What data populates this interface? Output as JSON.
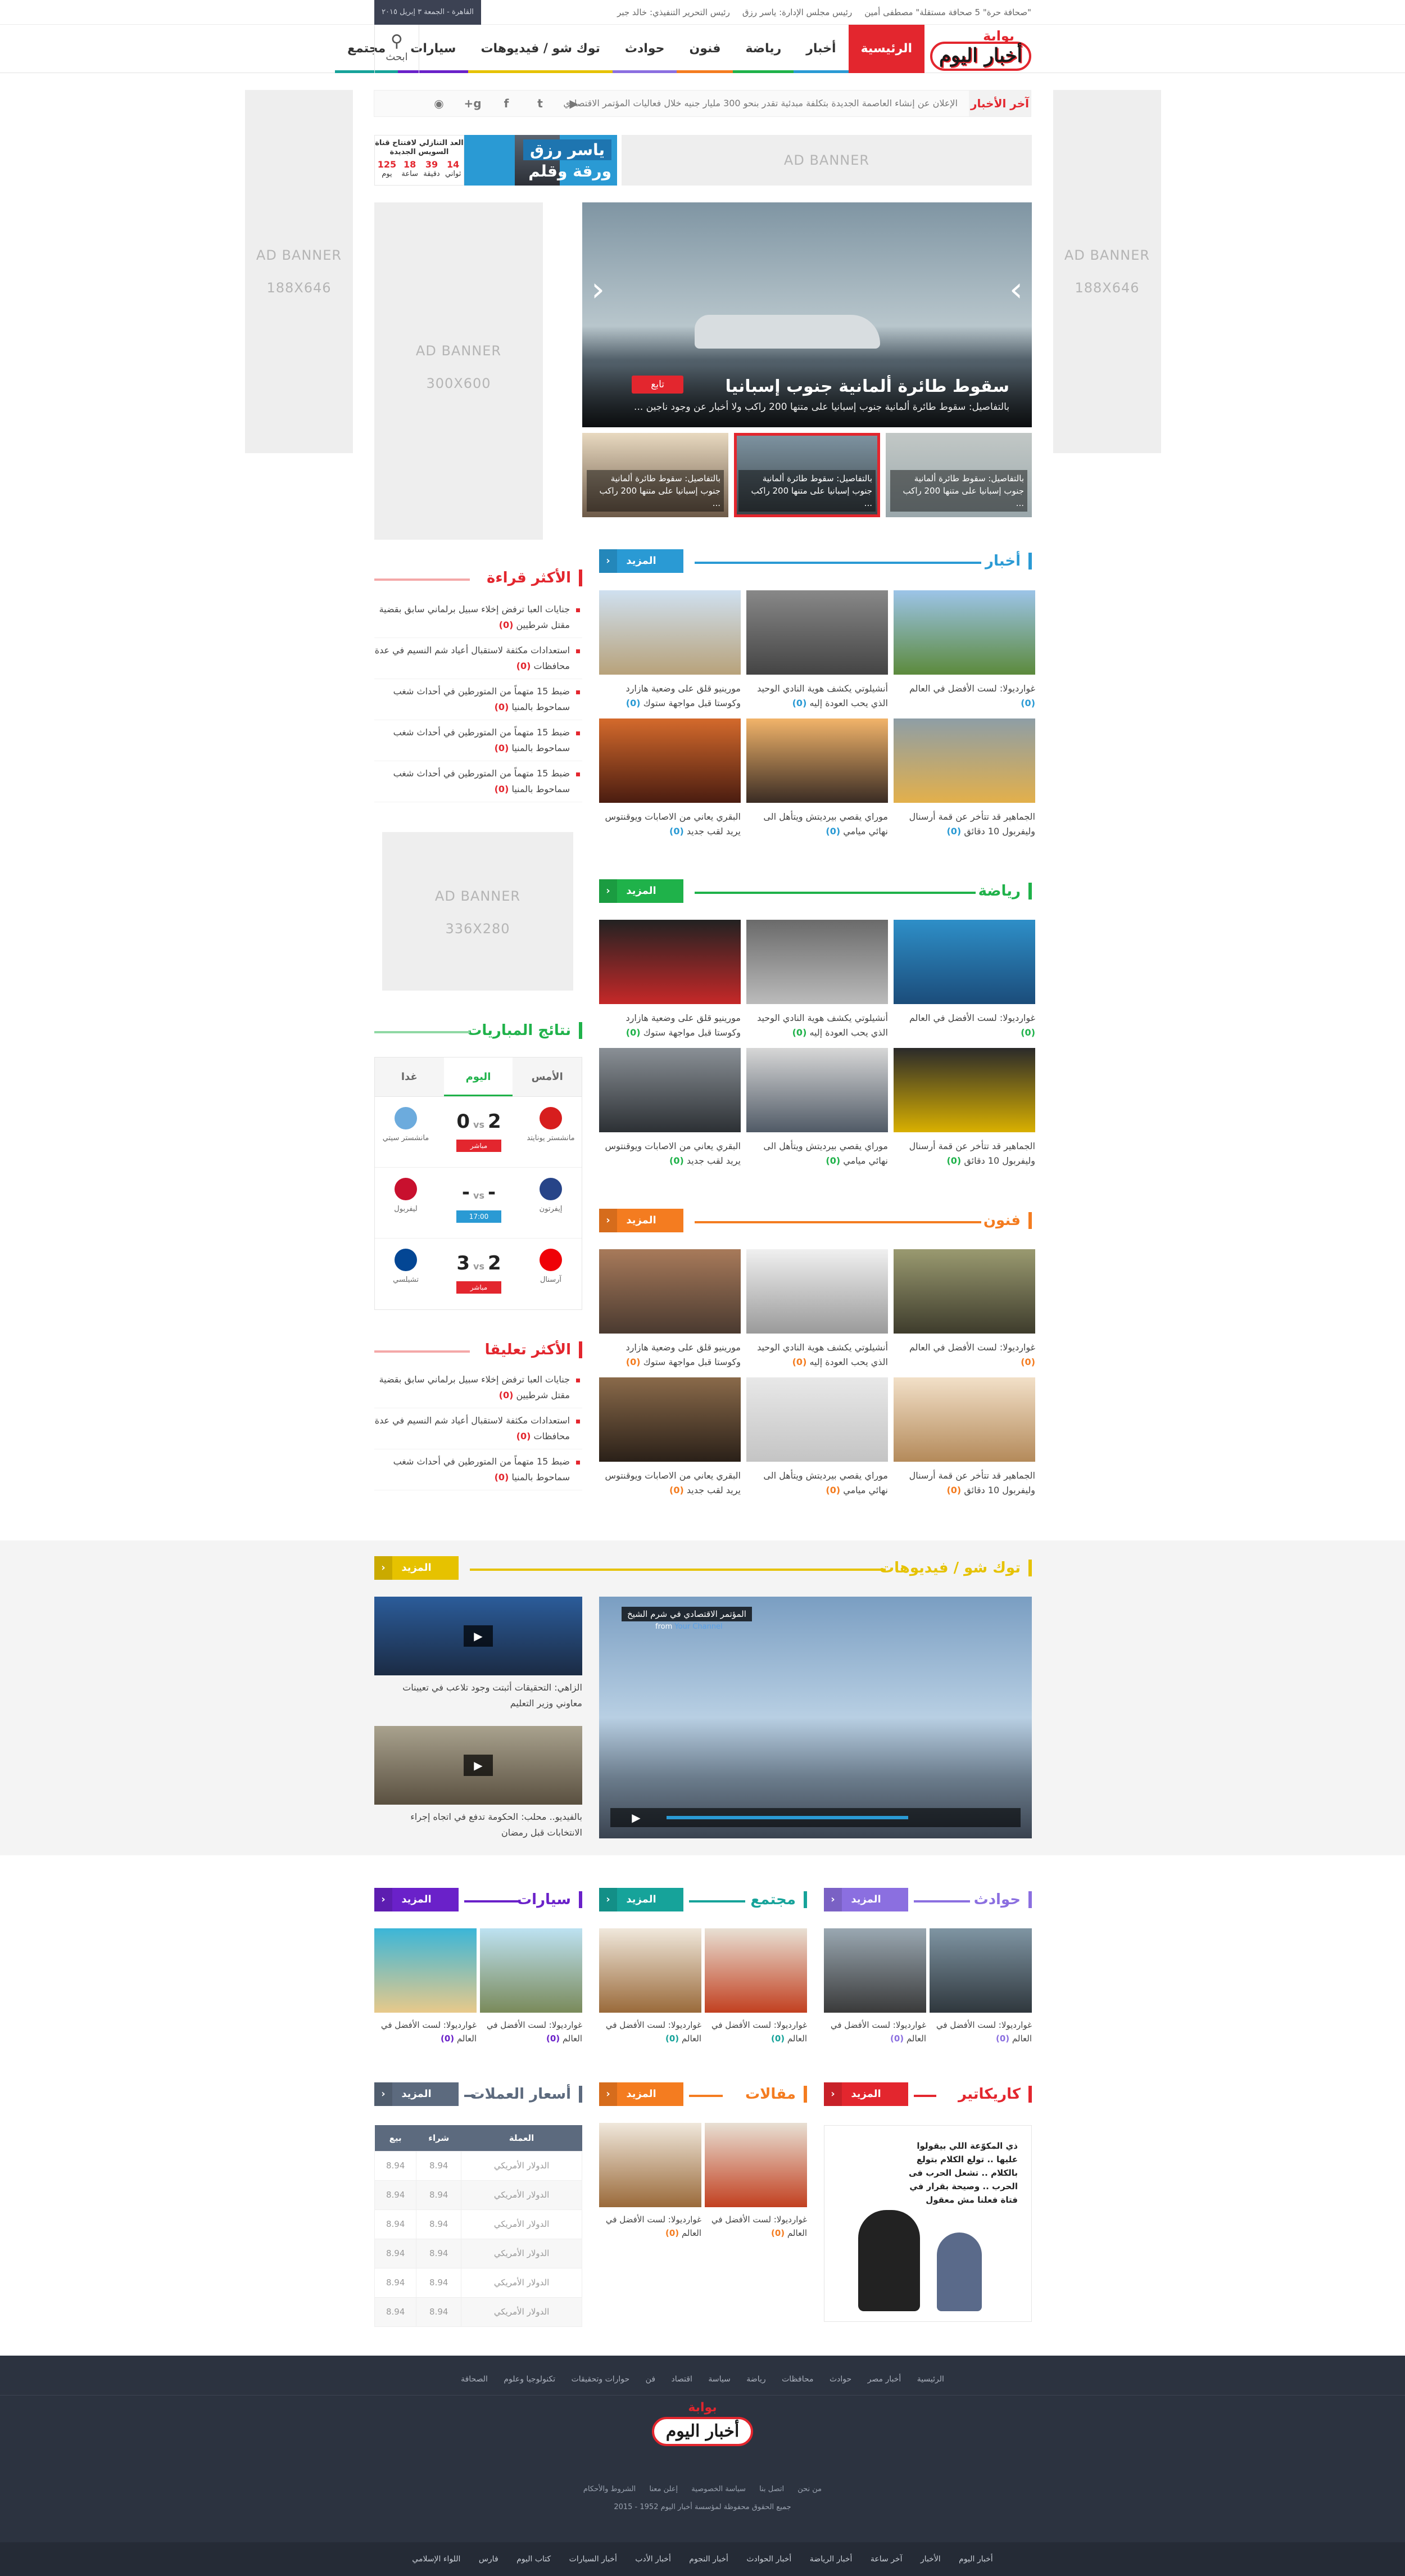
{
  "topbar": {
    "date": "القاهرة - الجمعة ٣ إبريل ٢٠١٥",
    "links": [
      "\"صحافة حرة\" 5 صحافة مستقلة\" مصطفى أمين",
      "رئيس مجلس الإدارة: ياسر رزق",
      "رئيس التحرير التنفيذي: خالد جبر"
    ]
  },
  "nav": {
    "logo_top": "بوابة",
    "logo_main": "أخبار اليوم",
    "items": [
      "الرئيسية",
      "أخبار",
      "رياضة",
      "فنون",
      "حوادث",
      "توك شو / فيديوهات",
      "سيارات",
      "مجتمع"
    ],
    "search_label": "ابحث",
    "accent": "#e3262e"
  },
  "ads": {
    "side_left": [
      "AD BANNER",
      "188X646"
    ],
    "side_right": [
      "AD BANNER",
      "188X646"
    ],
    "top": "AD BANNER",
    "tall": [
      "AD BANNER",
      "300X600"
    ],
    "square": [
      "AD BANNER",
      "336X280"
    ]
  },
  "ticker": {
    "label": "آخر الأخبار",
    "text": "الإعلان عن إنشاء العاصمة الجديدة بتكلفة مبدئية تقدر بنحو 300 مليار جنيه خلال فعاليات المؤتمر الاقتصادي"
  },
  "social": [
    "rss-icon",
    "google-plus-icon",
    "facebook-icon",
    "twitter-icon",
    "youtube-icon"
  ],
  "countdown": {
    "title": "العد التنازلي لافتتاح قناة السويس الجديدة",
    "units": [
      {
        "value": "125",
        "label": "يوم"
      },
      {
        "value": "18",
        "label": "ساعة"
      },
      {
        "value": "39",
        "label": "دقيقة"
      },
      {
        "value": "14",
        "label": "ثواني"
      }
    ]
  },
  "columnist": {
    "title": "ورقة وقلم",
    "name": "ياسر رزق"
  },
  "slider": {
    "title": "سقوط طائرة ألمانية جنوب إسبانيا",
    "desc": "بالتفاصيل: سقوط طائرة ألمانية جنوب إسبانيا على متنها 200 راكب ولا أخبار عن وجود ناجين ...",
    "follow": "تابع",
    "thumbs": [
      "بالتفاصيل: سقوط طائرة ألمانية جنوب إسبانيا على متنها 200 راكب ...",
      "بالتفاصيل: سقوط طائرة ألمانية جنوب إسبانيا على متنها 200 راكب ...",
      "بالتفاصيل: سقوط طائرة ألمانية جنوب إسبانيا على متنها 200 راكب ..."
    ]
  },
  "more_label": "المزيد",
  "news": {
    "title": "أخبار",
    "color": "#2a9ad4",
    "items": [
      {
        "text": "غوارديولا: لست الأفضل في العالم",
        "c": "(0)"
      },
      {
        "text": "أنشيلوتي يكشف هوية النادي الوحيد الذي يحب العودة إليه",
        "c": "(0)"
      },
      {
        "text": "مورينيو قلق على وضعية هازارد وكوستا قبل مواجهة ستوك",
        "c": "(0)"
      },
      {
        "text": "الجماهير قد تتأخر عن قمة أرسنال وليفربول 10 دقائق",
        "c": "(0)"
      },
      {
        "text": "موراي يقصي بيرديتش ويتأهل الى نهائي ميامي",
        "c": "(0)"
      },
      {
        "text": "البقري يعاني من الاصابات ويوقنتوس يريد لقب جديد",
        "c": "(0)"
      }
    ]
  },
  "sports": {
    "title": "رياضة",
    "color": "#1fb24a",
    "items": [
      {
        "text": "غوارديولا: لست الأفضل في العالم",
        "c": "(0)"
      },
      {
        "text": "أنشيلوتي يكشف هوية النادي الوحيد الذي يحب العودة إليه",
        "c": "(0)"
      },
      {
        "text": "مورينيو قلق على وضعية هازارد وكوستا قبل مواجهة ستوك",
        "c": "(0)"
      },
      {
        "text": "الجماهير قد تتأخر عن قمة أرسنال وليفربول 10 دقائق",
        "c": "(0)"
      },
      {
        "text": "موراي يقصي بيرديتش ويتأهل الى نهائي ميامي",
        "c": "(0)"
      },
      {
        "text": "البقري يعاني من الاصابات ويوقنتوس يريد لقب جديد",
        "c": "(0)"
      }
    ]
  },
  "arts": {
    "title": "فنون",
    "color": "#f47c20",
    "items": [
      {
        "text": "غوارديولا: لست الأفضل في العالم",
        "c": "(0)"
      },
      {
        "text": "أنشيلوتي يكشف هوية النادي الوحيد الذي يحب العودة إليه",
        "c": "(0)"
      },
      {
        "text": "مورينيو قلق على وضعية هازارد وكوستا قبل مواجهة ستوك",
        "c": "(0)"
      },
      {
        "text": "الجماهير قد تتأخر عن قمة أرسنال وليفربول 10 دقائق",
        "c": "(0)"
      },
      {
        "text": "موراي يقصي بيرديتش ويتأهل الى نهائي ميامي",
        "c": "(0)"
      },
      {
        "text": "البقري يعاني من الاصابات ويوقنتوس يريد لقب جديد",
        "c": "(0)"
      }
    ]
  },
  "most_read": {
    "title": "الأكثر قراءة",
    "items": [
      {
        "text": "جنايات العبا ترفض إخلاء سبيل برلماني سابق بقضية مقتل شرطيين",
        "c": "(0)"
      },
      {
        "text": "استعدادات مكثفة لاستقبال أعياد شم النسيم في عدة محافظات",
        "c": "(0)"
      },
      {
        "text": "ضبط 15 متهماً من المتورطين في أحداث شغب سماحوط بالمنيا",
        "c": "(0)"
      },
      {
        "text": "ضبط 15 متهماً من المتورطين في أحداث شغب سماحوط بالمنيا",
        "c": "(0)"
      },
      {
        "text": "ضبط 15 متهماً من المتورطين في أحداث شغب سماحوط بالمنيا",
        "c": "(0)"
      }
    ]
  },
  "most_commented": {
    "title": "الأكثر تعليقا",
    "items": [
      {
        "text": "جنايات العبا ترفض إخلاء سبيل برلماني سابق بقضية مقتل شرطيين",
        "c": "(0)"
      },
      {
        "text": "استعدادات مكثفة لاستقبال أعياد شم النسيم في عدة محافظات",
        "c": "(0)"
      },
      {
        "text": "ضبط 15 متهماً من المتورطين في أحداث شغب سماحوط بالمنيا",
        "c": "(0)"
      }
    ]
  },
  "matches": {
    "title": "نتائج المباريات",
    "tabs": [
      "الأمس",
      "اليوم",
      "غدا"
    ],
    "rows": [
      {
        "home": "مانشستر يونايتد",
        "away": "مانشستر سيتي",
        "hs": "2",
        "as": "0",
        "vs": "vs",
        "status": "مباشر",
        "scolor": "#e3262e",
        "hcolor": "#d71e1e",
        "acolor": "#6cabdd"
      },
      {
        "home": "إيفرتون",
        "away": "ليفربول",
        "hs": "-",
        "as": "-",
        "vs": "vs",
        "status": "17:00",
        "scolor": "#2a9ad4",
        "hcolor": "#274488",
        "acolor": "#c8102e"
      },
      {
        "home": "آرسنال",
        "away": "تشيلسي",
        "hs": "2",
        "as": "3",
        "vs": "vs",
        "status": "مباشر",
        "scolor": "#e3262e",
        "hcolor": "#ef0107",
        "acolor": "#034694"
      }
    ]
  },
  "videos": {
    "title": "توك شو / فيديوهات",
    "color": "#e6c200",
    "main_title": "المؤتمر الاقتصادي في شرم الشيخ",
    "main_from": "from",
    "main_channel": "Your Channel",
    "side": [
      "الزاهي: التحقيقات أثبتت وجود تلاعب في تعيينات معاوني وزير التعليم",
      "بالفيديو.. محلب: الحكومة تدفع في اتجاه إجراء الانتخابات قبل رمضان"
    ]
  },
  "accidents": {
    "title": "حوادث",
    "color": "#8b6fe0",
    "items": [
      "غوارديولا: لست الأفضل في العالم",
      "غوارديولا: لست الأفضل في العالم"
    ],
    "c": "(0)"
  },
  "society": {
    "title": "مجتمع",
    "color": "#16a39a",
    "items": [
      "غوارديولا: لست الأفضل في العالم",
      "غوارديولا: لست الأفضل في العالم"
    ],
    "c": "(0)"
  },
  "cars": {
    "title": "سيارات",
    "color": "#6a21c9",
    "items": [
      "غوارديولا: لست الأفضل في العالم",
      "غوارديولا: لست الأفضل في العالم"
    ],
    "c": "(0)"
  },
  "caricature": {
    "title": "كاريكاتير",
    "color": "#e3262e",
    "caption": "ذي المكوّعة اللي بيقولوا عليها .. تولع الكلام بتولع بالكلام .. تشعل الحرب فى الحرب .. وصيحة بقرار في فتاة فعلنا مش معقول"
  },
  "articles": {
    "title": "مقالات",
    "color": "#f47c20",
    "items": [
      "غوارديولا: لست الأفضل في العالم",
      "غوارديولا: لست الأفضل في العالم"
    ],
    "c": "(0)"
  },
  "currency": {
    "title": "أسعار العملات",
    "color": "#5c6a7e",
    "headers": [
      "العملة",
      "شراء",
      "بيع"
    ],
    "rows": [
      [
        "الدولار الأمريكي",
        "8.94",
        "8.94"
      ],
      [
        "الدولار الأمريكي",
        "8.94",
        "8.94"
      ],
      [
        "الدولار الأمريكي",
        "8.94",
        "8.94"
      ],
      [
        "الدولار الأمريكي",
        "8.94",
        "8.94"
      ],
      [
        "الدولار الأمريكي",
        "8.94",
        "8.94"
      ],
      [
        "الدولار الأمريكي",
        "8.94",
        "8.94"
      ]
    ]
  },
  "footer": {
    "links": [
      "الرئيسية",
      "أخبار مصر",
      "حوادث",
      "محافظات",
      "رياضة",
      "سياسة",
      "اقتصاد",
      "فن",
      "حوارات وتحقيقات",
      "تكنولوجيا وعلوم",
      "الصحافة"
    ],
    "logo_top": "بوابة",
    "logo_main": "أخبار اليوم",
    "sub_links": [
      "من نحن",
      "اتصل بنا",
      "سياسة الخصوصية",
      "إعلن معنا",
      "الشروط والأحكام"
    ],
    "copyright": "جميع الحقوق محفوظة لمؤسسة أخبار اليوم 1952 - 2015",
    "bottom": [
      "أخبار اليوم",
      "الأخبار",
      "آخر ساعة",
      "أخبار الرياضة",
      "أخبار الحوادث",
      "أخبار النجوم",
      "أخبار الأدب",
      "أخبار السيارات",
      "كتاب اليوم",
      "فارس",
      "اللواء الإسلامي"
    ]
  }
}
